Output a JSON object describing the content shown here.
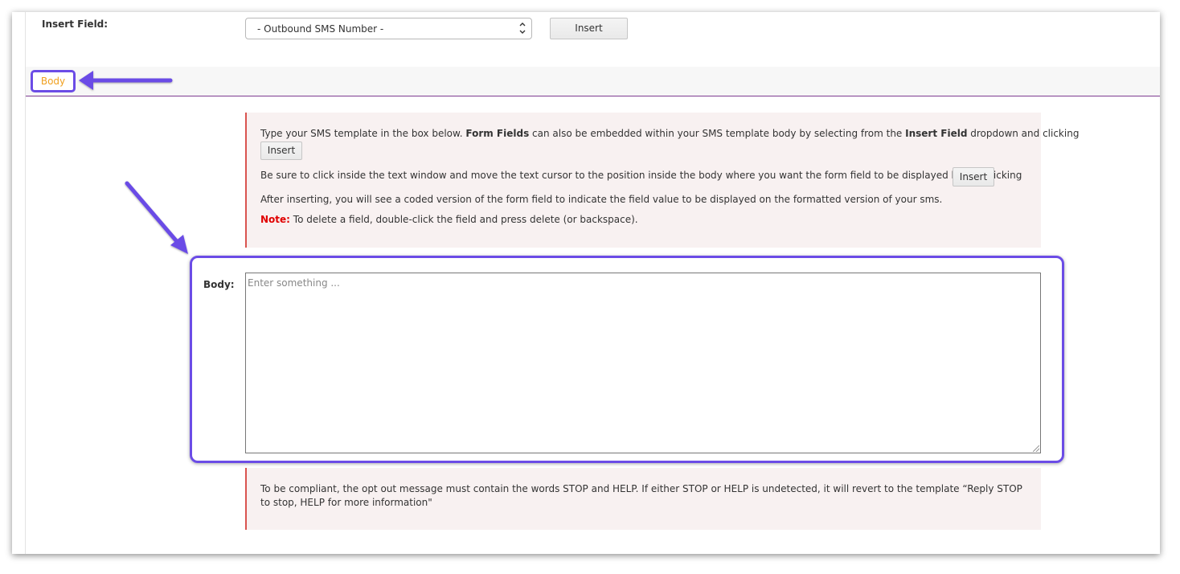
{
  "insert_field": {
    "label": "Insert Field:",
    "select_value": "- Outbound SMS Number -",
    "insert_button": "Insert"
  },
  "tabs": {
    "body_tab": "Body"
  },
  "info_panel": {
    "line1_pre": "Type your SMS template in the box below.  ",
    "line1_bold1": "Form Fields",
    "line1_mid": " can also be embedded within your SMS template body by selecting from the ",
    "line1_bold2": "Insert Field",
    "line1_post": " dropdown and clicking",
    "insert_button_1": "Insert",
    "line2": "Be sure to click inside the text window and move the text cursor to the position inside the body where you want the form field to be displayed before clicking",
    "insert_button_2": "Insert",
    "line3": "After inserting, you will see a coded version of the form field to indicate the field value to be displayed on the formatted version of your sms.",
    "note_label": "Note:",
    "note_text": " To delete a field, double-click the field and press delete (or backspace)."
  },
  "body_field": {
    "label": "Body:",
    "placeholder": "Enter something ..."
  },
  "compliance_panel": {
    "text": "To be compliant, the opt out message must contain the words STOP and HELP. If either STOP or HELP is undetected, it will revert to the template “Reply STOP to stop, HELP for more information\""
  },
  "colors": {
    "annotation": "#6b4ce6",
    "tab_text": "#f0a020",
    "note": "#e00000",
    "panel_border": "#d9544f",
    "panel_bg": "#f8f1f1",
    "divider": "#7e3c91"
  }
}
